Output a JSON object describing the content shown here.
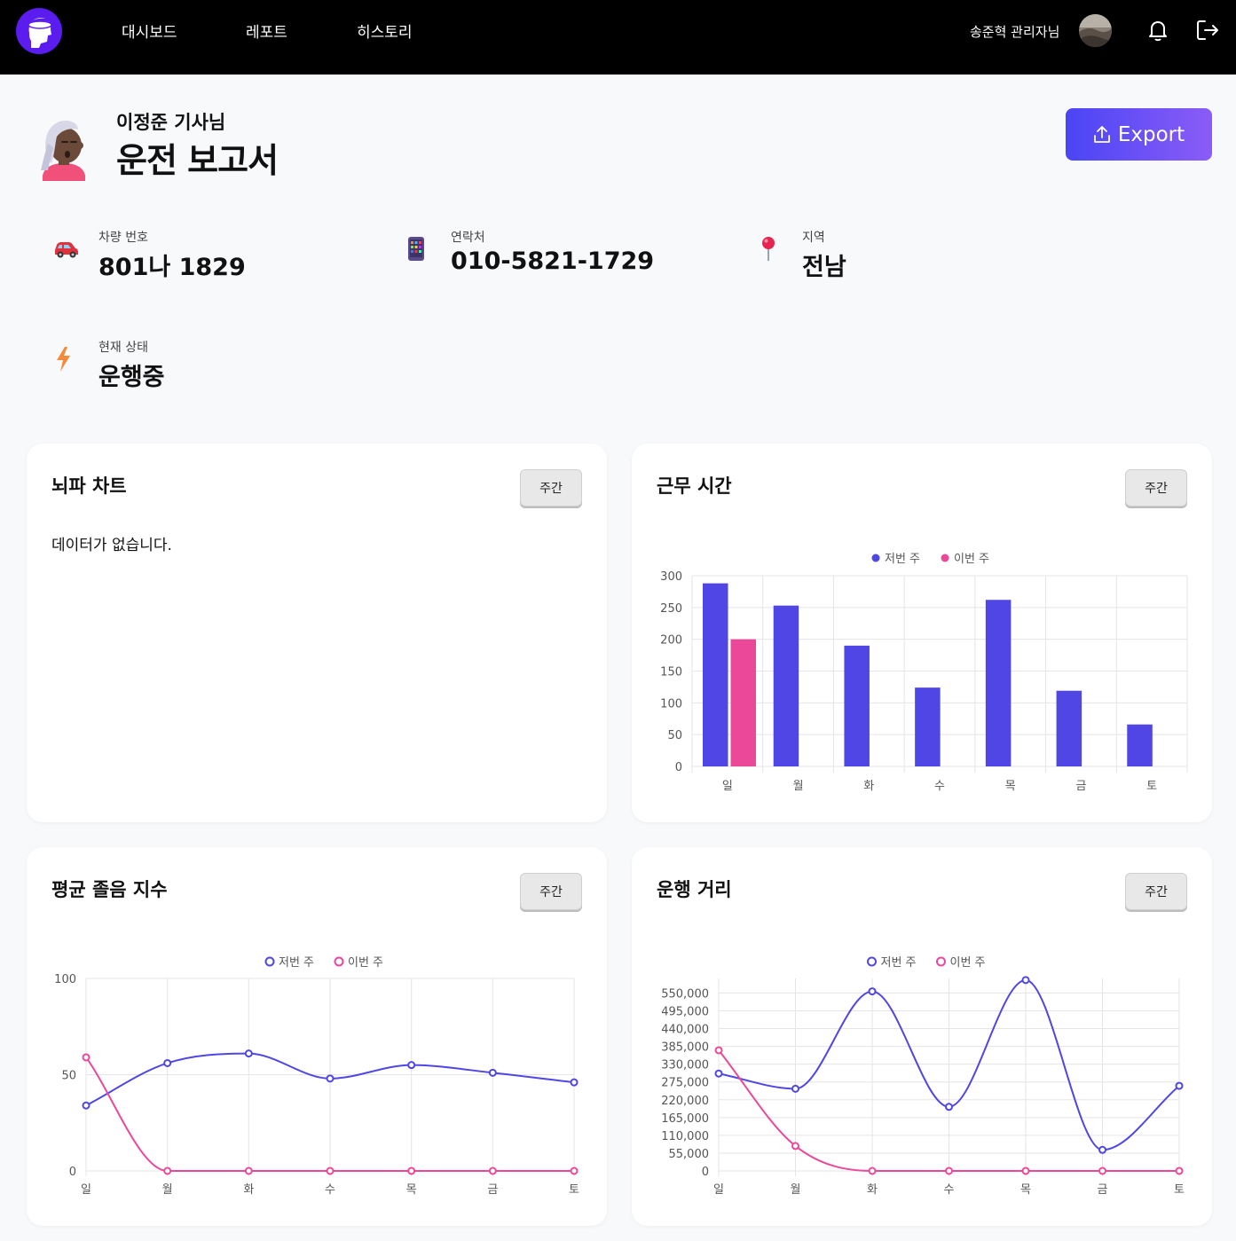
{
  "header": {
    "nav": [
      "대시보드",
      "레포트",
      "히스토리"
    ],
    "admin_label": "송준혁 관리자님"
  },
  "driver": {
    "name": "이정준 기사님",
    "title": "운전 보고서"
  },
  "export_label": "Export",
  "info": {
    "vehicle_label": "차량 번호",
    "vehicle_value": "801나 1829",
    "contact_label": "연락처",
    "contact_value": "010-5821-1729",
    "region_label": "지역",
    "region_value": "전남",
    "status_label": "현재 상태",
    "status_value": "운행중"
  },
  "cards": {
    "brainwave": {
      "title": "뇌파 차트",
      "period": "주간",
      "empty": "데이터가 없습니다."
    },
    "worktime": {
      "title": "근무 시간",
      "period": "주간"
    },
    "drowsy": {
      "title": "평균 졸음 지수",
      "period": "주간"
    },
    "distance": {
      "title": "운행 거리",
      "period": "주간"
    }
  },
  "colors": {
    "last_week": "#4f46e5",
    "this_week": "#ec4899",
    "accent": "#5b1cf0"
  },
  "chart_data": [
    {
      "type": "bar",
      "categories": [
        "일",
        "월",
        "화",
        "수",
        "목",
        "금",
        "토"
      ],
      "series": [
        {
          "name": "저번 주",
          "values": [
            288,
            253,
            190,
            124,
            262,
            119,
            66
          ]
        },
        {
          "name": "이번 주",
          "values": [
            200,
            0,
            0,
            0,
            0,
            0,
            0
          ]
        }
      ],
      "yticks": [
        0,
        50,
        100,
        150,
        200,
        250,
        300
      ],
      "ylim": [
        0,
        300
      ],
      "legend": "top-center",
      "grid": true
    },
    {
      "type": "line",
      "categories": [
        "일",
        "월",
        "화",
        "수",
        "목",
        "금",
        "토"
      ],
      "series": [
        {
          "name": "저번 주",
          "values": [
            34,
            56,
            61,
            48,
            55,
            51,
            46
          ]
        },
        {
          "name": "이번 주",
          "values": [
            59,
            0,
            0,
            0,
            0,
            0,
            0
          ]
        }
      ],
      "yticks": [
        0,
        50,
        100
      ],
      "ylim": [
        0,
        100
      ],
      "legend": "top-center",
      "grid": true
    },
    {
      "type": "line",
      "categories": [
        "일",
        "월",
        "화",
        "수",
        "목",
        "금",
        "토"
      ],
      "series": [
        {
          "name": "저번 주",
          "values": [
            301000,
            254000,
            555000,
            198000,
            590000,
            65000,
            263000
          ]
        },
        {
          "name": "이번 주",
          "values": [
            373000,
            77000,
            0,
            0,
            0,
            0,
            0
          ]
        }
      ],
      "yticks": [
        "0",
        "55,000",
        "110,000",
        "165,000",
        "220,000",
        "275,000",
        "330,000",
        "385,000",
        "440,000",
        "495,000",
        "550,000"
      ],
      "ylim": [
        0,
        595000
      ],
      "legend": "top-center",
      "grid": true
    }
  ]
}
